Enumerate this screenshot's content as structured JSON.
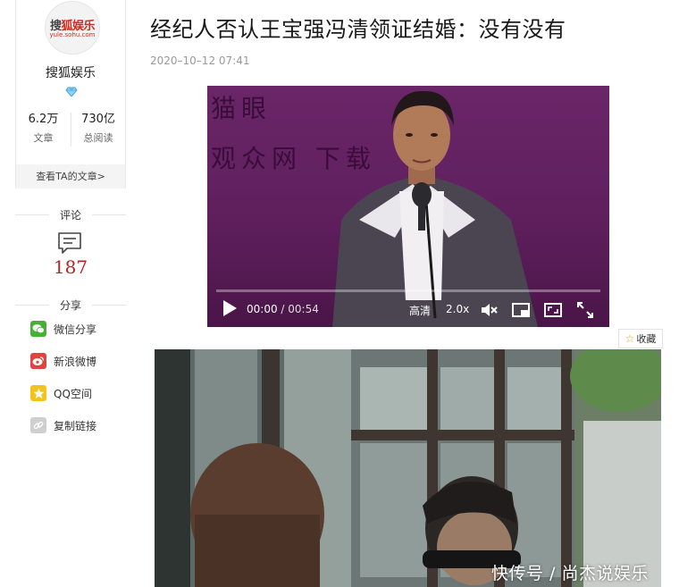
{
  "author": {
    "logo_text_main_a": "搜",
    "logo_text_main_b": "狐娱乐",
    "logo_text_sub": "yule.sohu.com",
    "name": "搜狐娱乐",
    "stats": [
      {
        "value": "6.2万",
        "label": "文章"
      },
      {
        "value": "730亿",
        "label": "总阅读"
      }
    ],
    "more_link": "查看TA的文章>"
  },
  "comments": {
    "title": "评论",
    "count": "187"
  },
  "share": {
    "title": "分享",
    "items": [
      {
        "label": "微信分享",
        "icon": "wechat-icon",
        "color": "#45b035"
      },
      {
        "label": "新浪微博",
        "icon": "weibo-icon",
        "color": "#e0443c"
      },
      {
        "label": "QQ空间",
        "icon": "qzone-star-icon",
        "color": "#f3c21b"
      },
      {
        "label": "复制链接",
        "icon": "link-icon",
        "color": "#cfcfcf"
      }
    ]
  },
  "article": {
    "title": "经纪人否认王宝强冯清领证结婚：没有没有",
    "time": "2020–10–12 07:41"
  },
  "video": {
    "bg_text_line1": "猫眼",
    "bg_text_line2": "观众网  下载",
    "current_time": "00:00",
    "separator": " / ",
    "duration": "00:54",
    "quality": "高清",
    "speed": "2.0x",
    "progress_fraction": 0.0
  },
  "favorite": {
    "label": "收藏"
  },
  "image": {
    "watermark": "快传号 / 尚杰说娱乐"
  },
  "colors": {
    "accent_red": "#b52323",
    "sohu_red": "#d9261c",
    "video_bg": "#6a2668"
  }
}
